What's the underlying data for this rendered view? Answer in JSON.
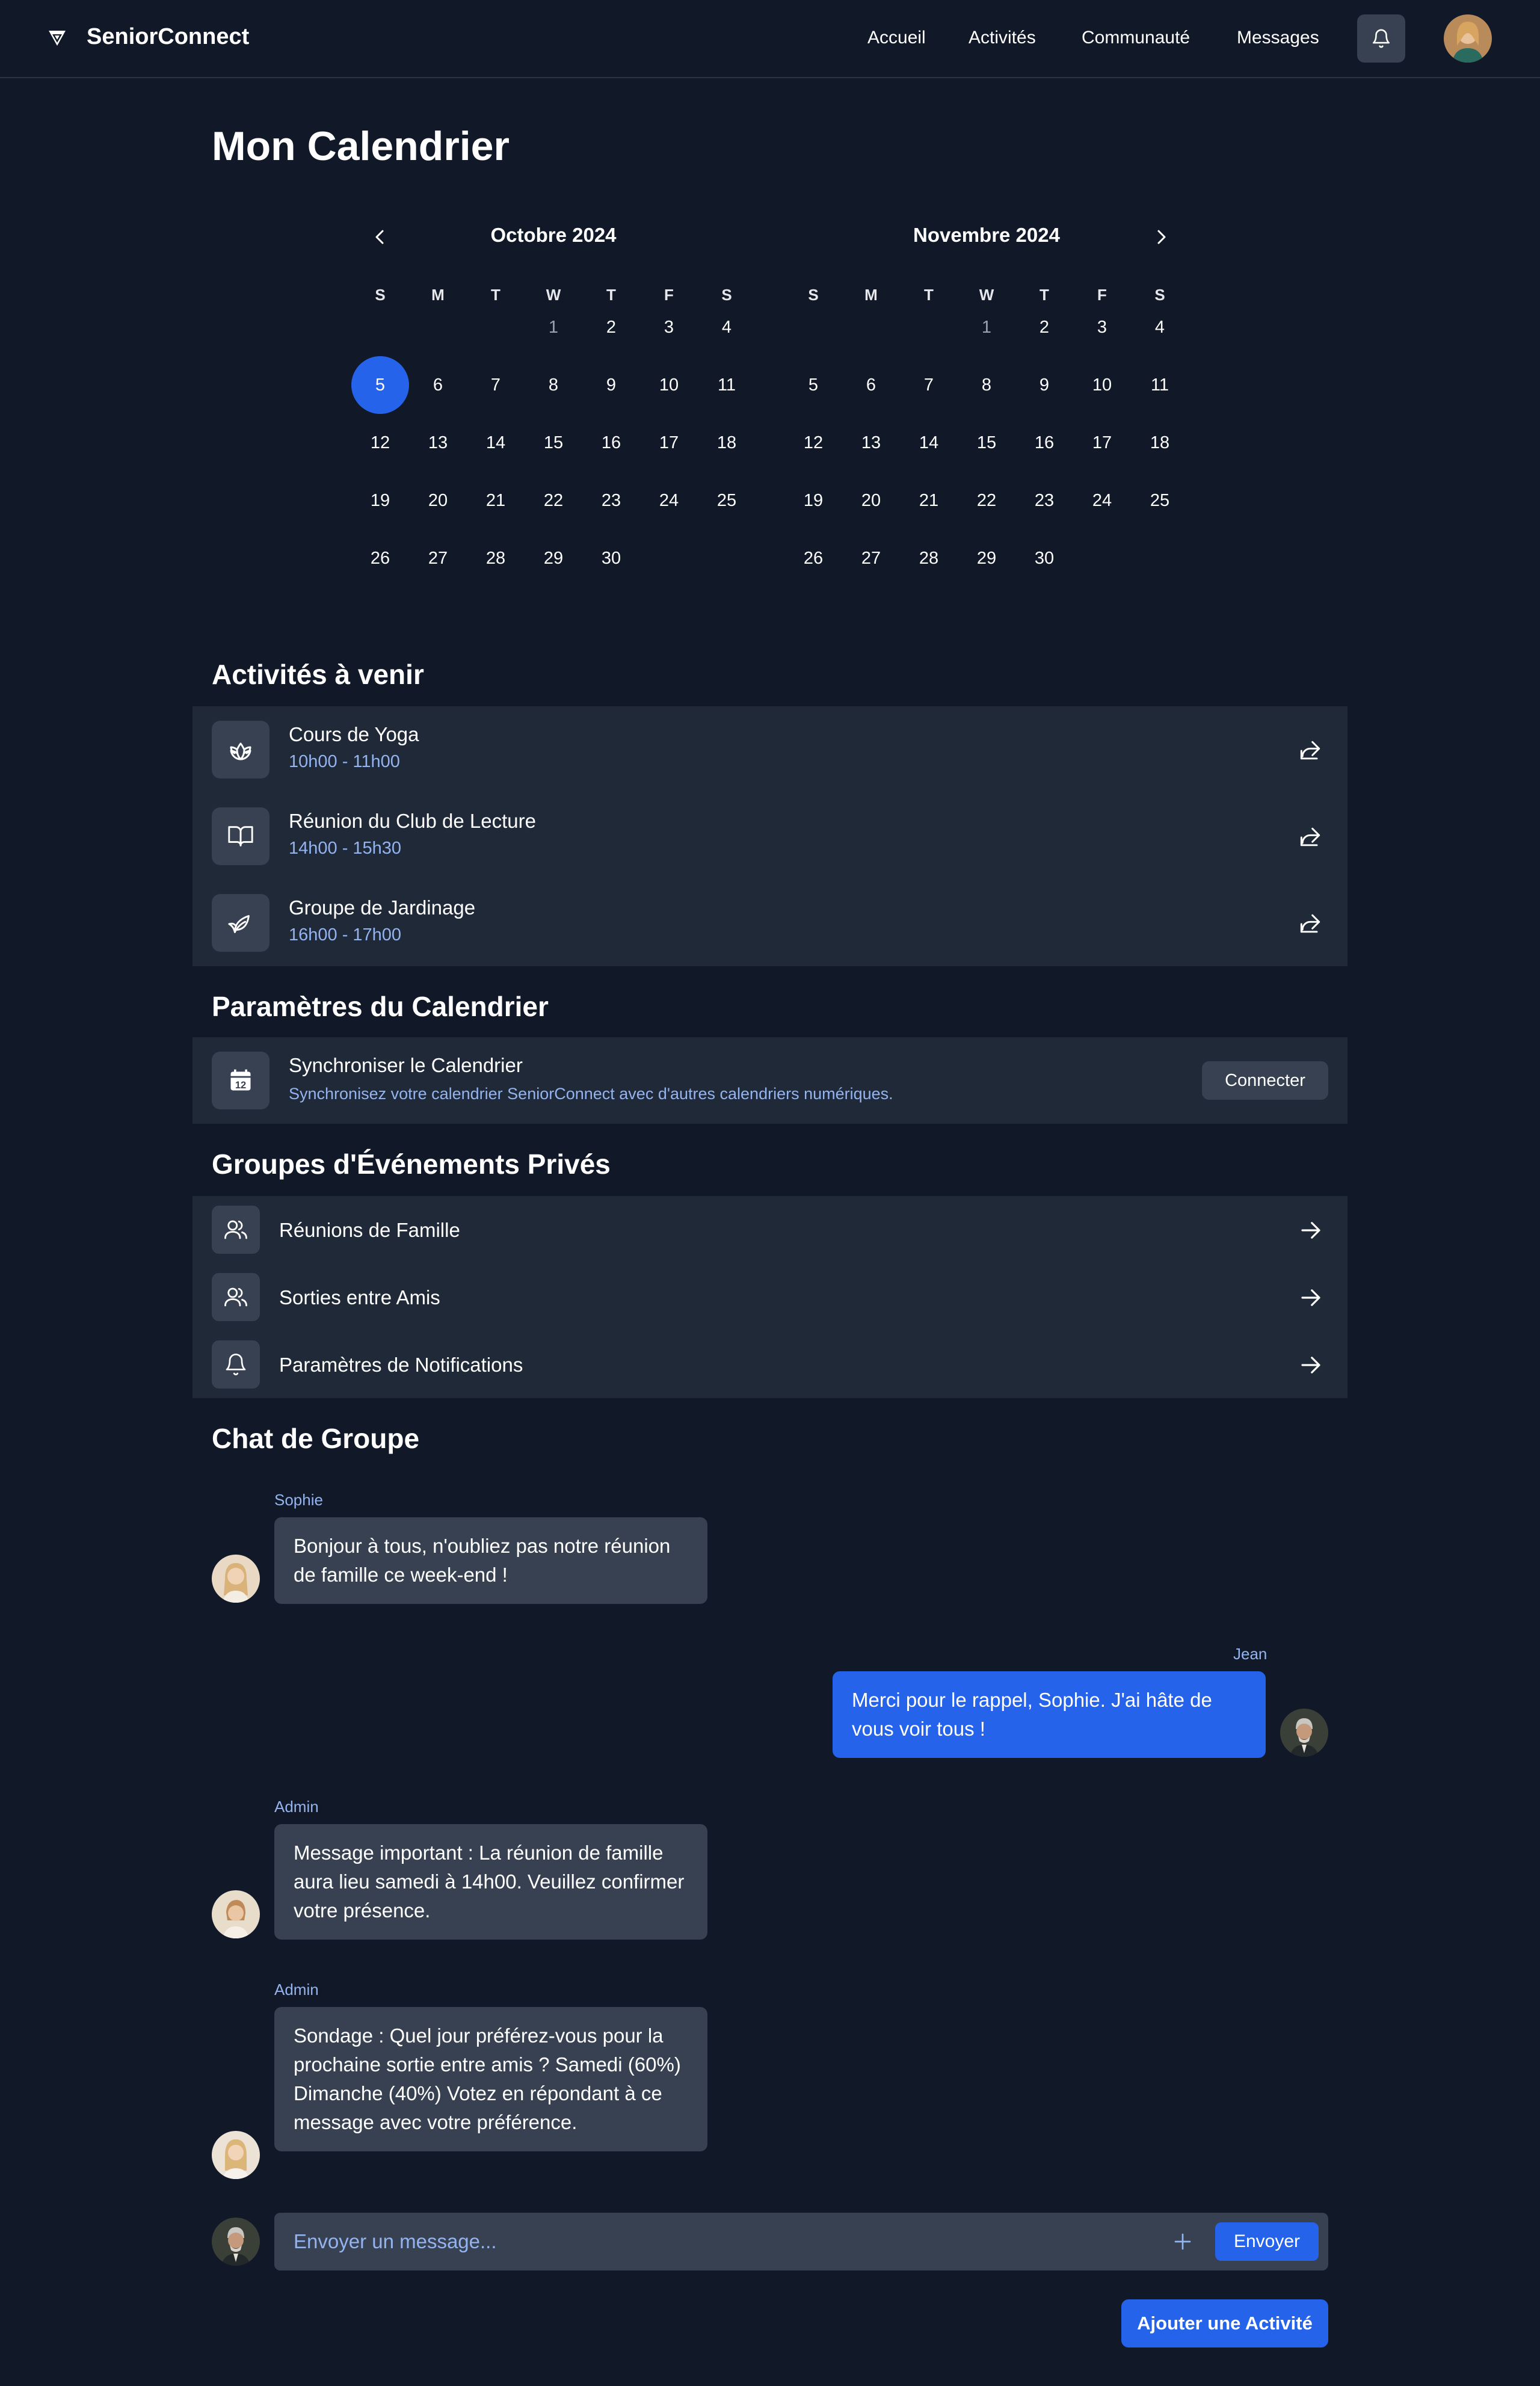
{
  "header": {
    "brand": "SeniorConnect",
    "nav": [
      "Accueil",
      "Activités",
      "Communauté",
      "Messages"
    ]
  },
  "page_title": "Mon Calendrier",
  "calendar": {
    "weekdays": [
      "S",
      "M",
      "T",
      "W",
      "T",
      "F",
      "S"
    ],
    "months": [
      {
        "title": "Octobre 2024",
        "weeks": [
          [
            "",
            "",
            "",
            "1",
            "2",
            "3",
            "4"
          ],
          [
            "5",
            "6",
            "7",
            "8",
            "9",
            "10",
            "11"
          ],
          [
            "12",
            "13",
            "14",
            "15",
            "16",
            "17",
            "18"
          ],
          [
            "19",
            "20",
            "21",
            "22",
            "23",
            "24",
            "25"
          ],
          [
            "26",
            "27",
            "28",
            "29",
            "30",
            "",
            ""
          ]
        ]
      },
      {
        "title": "Novembre 2024",
        "weeks": [
          [
            "",
            "",
            "",
            "1",
            "2",
            "3",
            "4"
          ],
          [
            "5",
            "6",
            "7",
            "8",
            "9",
            "10",
            "11"
          ],
          [
            "12",
            "13",
            "14",
            "15",
            "16",
            "17",
            "18"
          ],
          [
            "19",
            "20",
            "21",
            "22",
            "23",
            "24",
            "25"
          ],
          [
            "26",
            "27",
            "28",
            "29",
            "30",
            "",
            ""
          ]
        ]
      }
    ],
    "selected_day": "5",
    "muted_day": "1"
  },
  "upcoming": {
    "title": "Activités à venir",
    "items": [
      {
        "name": "Cours de Yoga",
        "time": "10h00 - 11h00",
        "icon": "lotus-icon"
      },
      {
        "name": "Réunion du Club de Lecture",
        "time": "14h00 - 15h30",
        "icon": "book-icon"
      },
      {
        "name": "Groupe de Jardinage",
        "time": "16h00 - 17h00",
        "icon": "leaf-icon"
      }
    ]
  },
  "settings": {
    "title": "Paramètres du Calendrier",
    "sync_title": "Synchroniser le Calendrier",
    "sync_desc": "Synchronisez votre calendrier SeniorConnect avec d'autres calendriers numériques.",
    "connect_label": "Connecter"
  },
  "groups": {
    "title": "Groupes d'Événements Privés",
    "items": [
      {
        "label": "Réunions de Famille",
        "icon": "users-icon"
      },
      {
        "label": "Sorties entre Amis",
        "icon": "users-icon"
      },
      {
        "label": "Paramètres de Notifications",
        "icon": "bell-icon"
      }
    ]
  },
  "chat": {
    "title": "Chat de Groupe",
    "messages": [
      {
        "sender": "Sophie",
        "text": "Bonjour à tous, n'oubliez pas notre réunion de famille ce week-end !",
        "side": "left"
      },
      {
        "sender": "Jean",
        "text": "Merci pour le rappel, Sophie. J'ai hâte de vous voir tous !",
        "side": "right"
      },
      {
        "sender": "Admin",
        "text": "Message important : La réunion de famille aura lieu samedi à 14h00. Veuillez confirmer votre présence.",
        "side": "left"
      },
      {
        "sender": "Admin",
        "text": "Sondage : Quel jour préférez-vous pour la prochaine sortie entre amis ? Samedi (60%) Dimanche (40%) Votez en répondant à ce message avec votre préférence.",
        "side": "left"
      }
    ],
    "input_placeholder": "Envoyer un message...",
    "send_label": "Envoyer"
  },
  "add_activity_label": "Ajouter une Activité",
  "colors": {
    "background": "#111827",
    "panel": "#1f2937",
    "accent": "#2563eb",
    "link": "#93b4f0"
  }
}
